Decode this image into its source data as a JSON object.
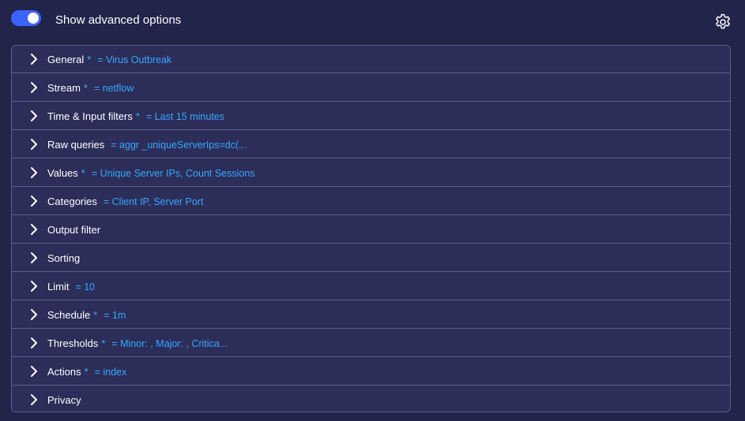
{
  "header": {
    "toggle_label": "Show advanced options",
    "toggle_on": true
  },
  "sections": [
    {
      "label": "General",
      "required": "*",
      "summary": "= Virus Outbreak"
    },
    {
      "label": "Stream",
      "required": "*",
      "summary": "= netflow"
    },
    {
      "label": "Time & Input filters",
      "required": "*",
      "summary": "= Last 15 minutes"
    },
    {
      "label": "Raw queries",
      "required": "",
      "summary": "= aggr _uniqueServerIps=dc(..."
    },
    {
      "label": "Values",
      "required": "*",
      "summary": "= Unique Server IPs, Count Sessions"
    },
    {
      "label": "Categories",
      "required": "",
      "summary": "= Client IP, Server Port"
    },
    {
      "label": "Output filter",
      "required": "",
      "summary": ""
    },
    {
      "label": "Sorting",
      "required": "",
      "summary": ""
    },
    {
      "label": "Limit",
      "required": "",
      "summary": "= 10"
    },
    {
      "label": "Schedule",
      "required": "*",
      "summary": "= 1m"
    },
    {
      "label": "Thresholds",
      "required": "*",
      "summary": "= Minor: , Major: , Critica..."
    },
    {
      "label": "Actions",
      "required": "*",
      "summary": "= index"
    },
    {
      "label": "Privacy",
      "required": "",
      "summary": ""
    }
  ],
  "colors": {
    "background": "#23244a",
    "panel": "#2c2d58",
    "accent": "#3d63ff",
    "value_text": "#35a9ff"
  },
  "icons": {
    "settings": "gear-icon",
    "expand": "chevron-right-icon"
  }
}
